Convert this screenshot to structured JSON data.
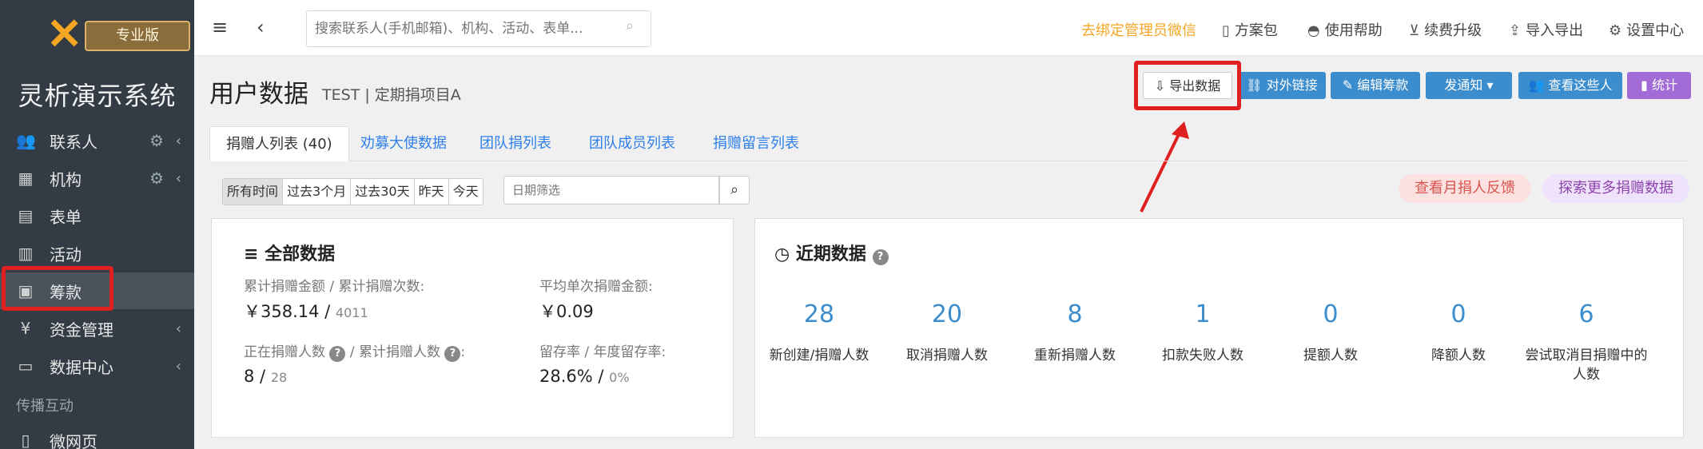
{
  "sidebar": {
    "logo_badge": "专业版",
    "system_title": "灵析演示系统",
    "items": [
      {
        "label": "联系人",
        "icon": "users-icon"
      },
      {
        "label": "机构",
        "icon": "building-icon"
      },
      {
        "label": "表单",
        "icon": "clipboard-icon"
      },
      {
        "label": "活动",
        "icon": "calendar-icon"
      },
      {
        "label": "筹款",
        "icon": "donation-icon"
      },
      {
        "label": "资金管理",
        "icon": "yen-icon"
      },
      {
        "label": "数据中心",
        "icon": "data-icon"
      }
    ],
    "section_label": "传播互动",
    "extra_item": {
      "label": "微网页",
      "icon": "page-icon"
    }
  },
  "topbar": {
    "search_placeholder": "搜索联系人(手机邮箱)、机构、活动、表单...",
    "bind_wechat": "去绑定管理员微信",
    "links": [
      "方案包",
      "使用帮助",
      "续费升级",
      "导入导出",
      "设置中心"
    ]
  },
  "header": {
    "title": "用户数据",
    "subtitle": "TEST | 定期捐项目A",
    "buttons": [
      "导出数据",
      "对外链接",
      "编辑筹款",
      "发通知",
      "查看这些人",
      "统计"
    ]
  },
  "tabs": [
    "捐赠人列表 (40)",
    "劝募大使数据",
    "团队捐列表",
    "团队成员列表",
    "捐赠留言列表"
  ],
  "filter": {
    "ranges": [
      "所有时间",
      "过去3个月",
      "过去30天",
      "昨天",
      "今天"
    ],
    "date_placeholder": "日期筛选",
    "feedback_btn": "查看月捐人反馈",
    "explore_btn": "探索更多捐赠数据"
  },
  "overall": {
    "title": "全部数据",
    "amount_label": "累计捐赠金额 / 累计捐赠次数:",
    "amount_value": "￥358.14 /",
    "amount_count": "4011",
    "avg_label": "平均单次捐赠金额:",
    "avg_value": "￥0.09",
    "donors_label_a": "正在捐赠人数",
    "donors_label_b": "/ 累计捐赠人数",
    "donors_label_c": ":",
    "donors_value": "8 /",
    "donors_total": "28",
    "retention_label": "留存率 / 年度留存率:",
    "retention_value": "28.6% /",
    "retention_year": "0%"
  },
  "recent": {
    "title": "近期数据",
    "stats": [
      {
        "num": "28",
        "label": "新创建/捐赠人数"
      },
      {
        "num": "20",
        "label": "取消捐赠人数"
      },
      {
        "num": "8",
        "label": "重新捐赠人数"
      },
      {
        "num": "1",
        "label": "扣款失败人数"
      },
      {
        "num": "0",
        "label": "提额人数"
      },
      {
        "num": "0",
        "label": "降额人数"
      },
      {
        "num": "6",
        "label": "尝试取消目捐赠中的人数"
      }
    ]
  },
  "colors": {
    "accent": "#3c8dcd",
    "highlight": "#e02020",
    "sidebar": "#333c44"
  }
}
